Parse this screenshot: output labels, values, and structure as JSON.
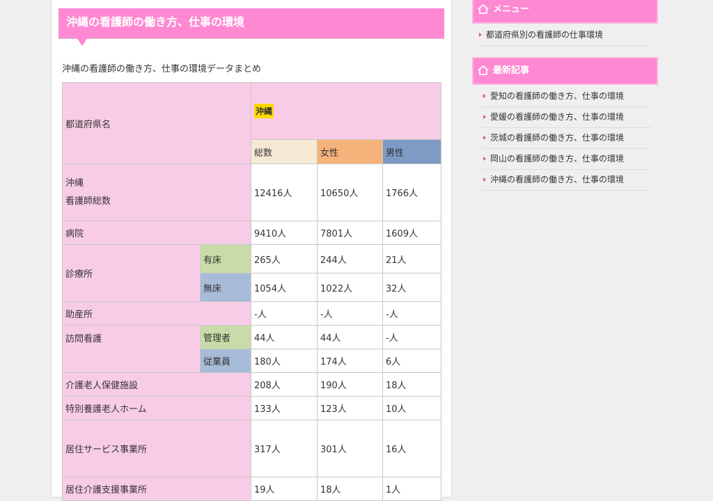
{
  "article": {
    "title": "沖縄の看護師の働き方、仕事の環境",
    "subtitle": "沖縄の看護師の働き方、仕事の環境データまとめ"
  },
  "table": {
    "pref_header": "都道府県名",
    "pref_name": "沖縄",
    "columns": {
      "total": "総数",
      "female": "女性",
      "male": "男性"
    },
    "rows": {
      "all": {
        "label": "沖縄\n看護師総数",
        "total": "12416人",
        "female": "10650人",
        "male": "1766人"
      },
      "hospital": {
        "label": "病院",
        "total": "9410人",
        "female": "7801人",
        "male": "1609人"
      },
      "clinic": {
        "label": "診療所",
        "beds": {
          "label": "有床",
          "total": "265人",
          "female": "244人",
          "male": "21人"
        },
        "nobeds": {
          "label": "無床",
          "total": "1054人",
          "female": "1022人",
          "male": "32人"
        }
      },
      "midwife": {
        "label": "助産所",
        "total": "-人",
        "female": "-人",
        "male": "-人"
      },
      "visiting": {
        "label": "訪問看護",
        "manager": {
          "label": "管理者",
          "total": "44人",
          "female": "44人",
          "male": "-人"
        },
        "staff": {
          "label": "従業員",
          "total": "180人",
          "female": "174人",
          "male": "6人"
        }
      },
      "elderly_health": {
        "label": "介護老人保健施設",
        "total": "208人",
        "female": "190人",
        "male": "18人"
      },
      "special_nursing": {
        "label": "特別養護老人ホーム",
        "total": "133人",
        "female": "123人",
        "male": "10人"
      },
      "home_service": {
        "label": "居住サービス事業所",
        "total": "317人",
        "female": "301人",
        "male": "16人"
      },
      "care_support": {
        "label": "居住介護支援事業所",
        "total": "19人",
        "female": "18人",
        "male": "1人"
      }
    }
  },
  "sidebar": {
    "menu_title": "メニュー",
    "menu_items": [
      "都道府県別の看護師の仕事環境"
    ],
    "recent_title": "最新記事",
    "recent_items": [
      "愛知の看護師の働き方、仕事の環境",
      "愛媛の看護師の働き方、仕事の環境",
      "茨城の看護師の働き方、仕事の環境",
      "岡山の看護師の働き方、仕事の環境",
      "沖縄の看護師の働き方、仕事の環境"
    ]
  },
  "colors": {
    "accent_pink": "#ff88d2",
    "table_pink": "#f8cce6",
    "pref_highlight": "#ffd800",
    "col_total": "#f6e9d4",
    "col_female": "#f6b27b",
    "col_male": "#7d9bc4"
  },
  "icons": {
    "sidebar_heading": "house-icon",
    "list_bullet": "triangle-bullet-icon"
  }
}
